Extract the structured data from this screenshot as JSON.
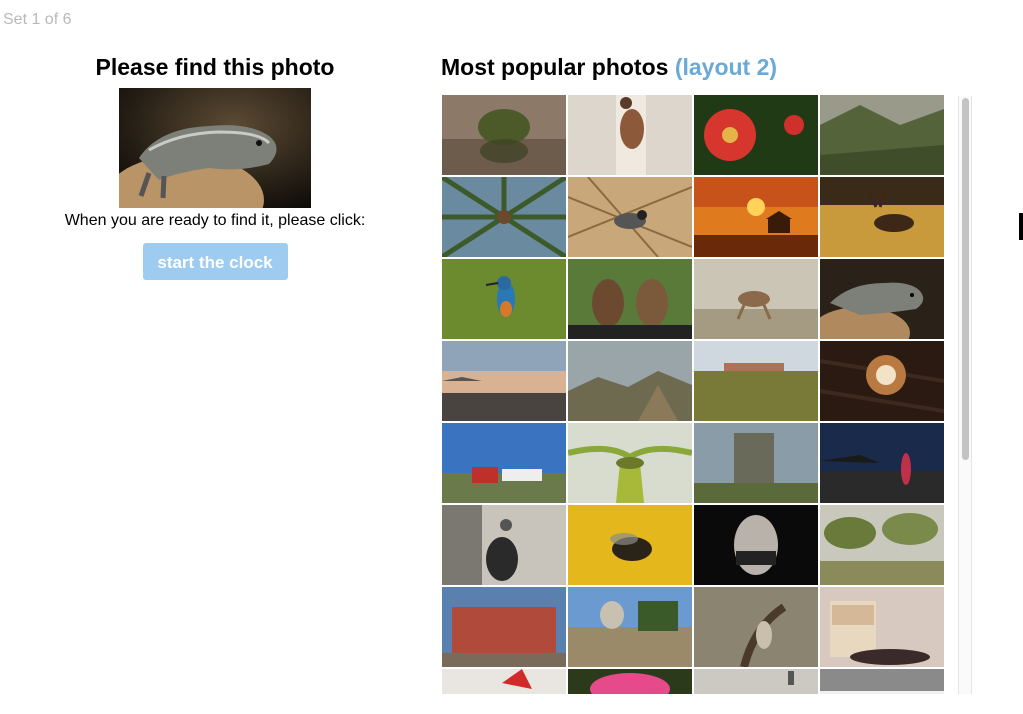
{
  "set_label": "Set 1 of 6",
  "left": {
    "heading": "Please find this photo",
    "target_photo": "iguana-on-rock",
    "instruction": "When you are ready to find it, please click:",
    "start_button": "start the clock"
  },
  "right": {
    "heading": "Most popular photos",
    "heading_accent": "(layout 2)",
    "accent_color": "#6ba9d6"
  },
  "photos": [
    {
      "subject": "island-tree-reflection"
    },
    {
      "subject": "woman-holding-fox"
    },
    {
      "subject": "red-dahlia"
    },
    {
      "subject": "mountain-valley"
    },
    {
      "subject": "palm-tree-from-below"
    },
    {
      "subject": "bird-in-grass"
    },
    {
      "subject": "sunset-gazebo"
    },
    {
      "subject": "elk-in-field"
    },
    {
      "subject": "kingfisher"
    },
    {
      "subject": "donkeys-in-car-window"
    },
    {
      "subject": "foal-running"
    },
    {
      "subject": "iguana-on-rock"
    },
    {
      "subject": "beach-at-dusk"
    },
    {
      "subject": "rocky-hills"
    },
    {
      "subject": "desert-ruins"
    },
    {
      "subject": "latte-art-coffee"
    },
    {
      "subject": "red-house-blue-sky"
    },
    {
      "subject": "orchid-macro"
    },
    {
      "subject": "stone-tower-ruin"
    },
    {
      "subject": "night-coast-figure"
    },
    {
      "subject": "woman-balcony-bw"
    },
    {
      "subject": "fly-on-yellow"
    },
    {
      "subject": "boy-face-dark"
    },
    {
      "subject": "olive-grove"
    },
    {
      "subject": "red-church"
    },
    {
      "subject": "city-square"
    },
    {
      "subject": "man-under-tree"
    },
    {
      "subject": "cup-of-tea"
    },
    {
      "subject": "red-flower-partial"
    },
    {
      "subject": "pink-flower-partial"
    },
    {
      "subject": "foggy-landscape-partial"
    },
    {
      "subject": "gray-gradient-partial"
    }
  ]
}
